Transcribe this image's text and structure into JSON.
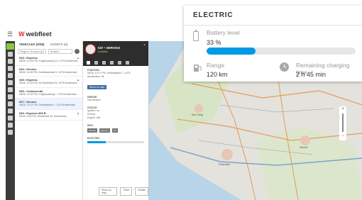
{
  "app": {
    "logo_text": "webfleet"
  },
  "vehicles_panel": {
    "tab_vehicles": "VEHICLES (6/35)",
    "tab_assets": "ASSETS (4)",
    "filter": "Region: Europe (6)",
    "search_placeholder": "Search",
    "items": [
      {
        "title": "033 • Express",
        "sub": "08/26, 10:15 PM, Zuigerpadweg 13, 1075 Amsterdam"
      },
      {
        "title": "034 • Service",
        "sub": "08/26, 11:08 PM, Drieflandstraat 5, 1075 Amsterdam"
      },
      {
        "title": "035 • Express",
        "sub": "08/26, 10:22 PM, De Boelelaan 32, 1075 Amsterdam"
      },
      {
        "title": "036 • Commercial",
        "sub": "08/26, 10:20 PM, Zuigerpadweg 7, 1075 Amsterdam"
      },
      {
        "title": "037 • Service",
        "sub": "08/26, 10:17 PM, Delflandplein 7, 1075 Amsterdam"
      },
      {
        "title": "033 • Express 003 B",
        "sub": "08/26, 8:30 PM, Westerdok 13, Amsterdam"
      }
    ]
  },
  "detail_panel": {
    "name": "037 • SERVICE",
    "status": "Available",
    "close": "×",
    "position_label": "POSITION",
    "position_value": "08/26, 10:17 PM, Delflandplein 7, 1075 Amsterdam, NL",
    "action_button": "Show on map",
    "driver_label": "DRIVER",
    "driver_value": "Ivan Bergen",
    "status_label": "STATUS",
    "status_values": [
      "Ignition: on",
      "Driving",
      "Engine: idle"
    ],
    "info_label": "INFO",
    "chips": [
      "Service",
      "Express",
      "EV"
    ],
    "electric_label": "ELECTRIC",
    "battery_fraction": 0.33,
    "footer_buttons": [
      "Show on map",
      "Trace",
      "Details"
    ]
  },
  "popup": {
    "title": "ELECTRIC",
    "battery_label": "Battery level",
    "battery_value": "33 %",
    "battery_fraction": 0.33,
    "range_label": "Range",
    "range_value": "120 km",
    "charge_label": "Remaining charging time",
    "charge_value": "2 h 45 min"
  },
  "map": {
    "cities": [
      "Rotterdam",
      "Den Haag",
      "Utrecht"
    ],
    "zoom_in": "+",
    "zoom_out": "−"
  },
  "colors": {
    "accent": "#0099e5",
    "brand_red": "#e32c2c",
    "rail_active": "#8dc63f",
    "dark_panel": "#2d2d2d"
  }
}
